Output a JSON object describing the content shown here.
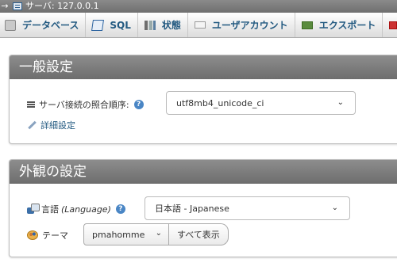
{
  "topbar": {
    "arrow": "→",
    "server_label": "サーバ: 127.0.0.1"
  },
  "tabs": [
    {
      "label": "データベース",
      "icon": "database-icon"
    },
    {
      "label": "SQL",
      "icon": "sql-icon"
    },
    {
      "label": "状態",
      "icon": "status-icon"
    },
    {
      "label": "ユーザアカウント",
      "icon": "users-icon"
    },
    {
      "label": "エクスポート",
      "icon": "export-icon"
    }
  ],
  "general": {
    "title": "一般設定",
    "collation_label": "サーバ接続の照合順序:",
    "collation_value": "utf8mb4_unicode_ci",
    "help_glyph": "?",
    "more_settings": "詳細設定"
  },
  "appearance": {
    "title": "外観の設定",
    "language_label": "言語 ",
    "language_label_italic": "(Language)",
    "language_value": "日本語 - Japanese",
    "theme_label": "テーマ",
    "theme_value": "pmahomme",
    "view_all": "すべて表示"
  },
  "glyphs": {
    "chevron": "⌄"
  }
}
